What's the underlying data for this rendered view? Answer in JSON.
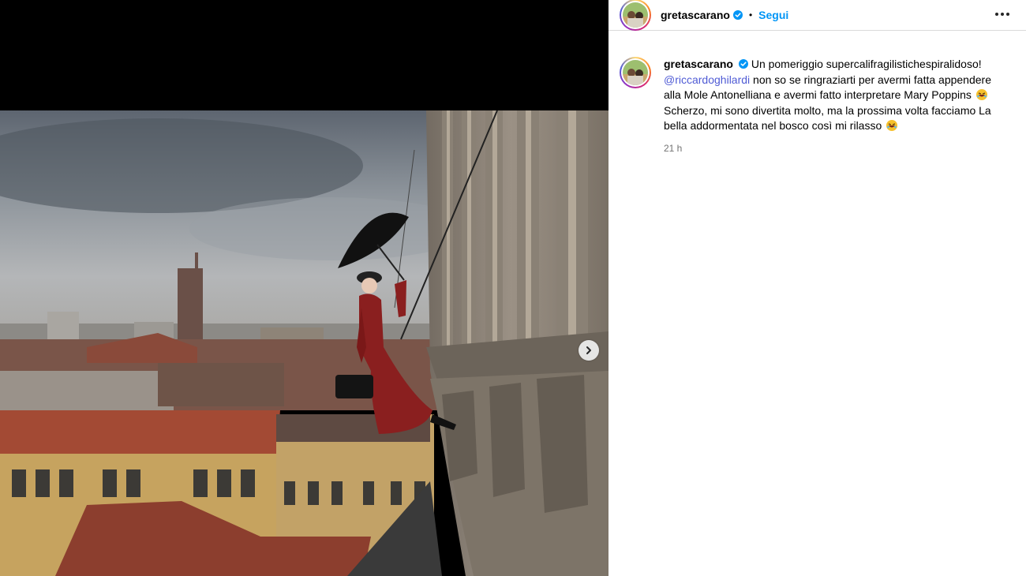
{
  "post": {
    "username": "gretascarano",
    "follow_label": "Segui",
    "separator": "•",
    "caption_part1": "Un pomeriggio supercalifragilistichespiralidoso!",
    "mention": "@riccardoghilardi",
    "caption_part2": " non so se ringraziarti per avermi fatta appendere alla Mole Antonelliana e avermi fatto interpretare Mary Poppins",
    "caption_part3": " Scherzo, mi sono divertita molto, ma la prossima volta facciamo La bella addormentata nel bosco così mi rilasso",
    "timestamp": "21 h"
  },
  "icons": {
    "verified": "verified-badge-icon",
    "more": "more-options-icon",
    "next": "chevron-right-icon",
    "emoji": "rolling-laughing-emoji"
  },
  "colors": {
    "accent": "#0095f6",
    "mention": "#4f5bd5",
    "muted": "#737373"
  }
}
